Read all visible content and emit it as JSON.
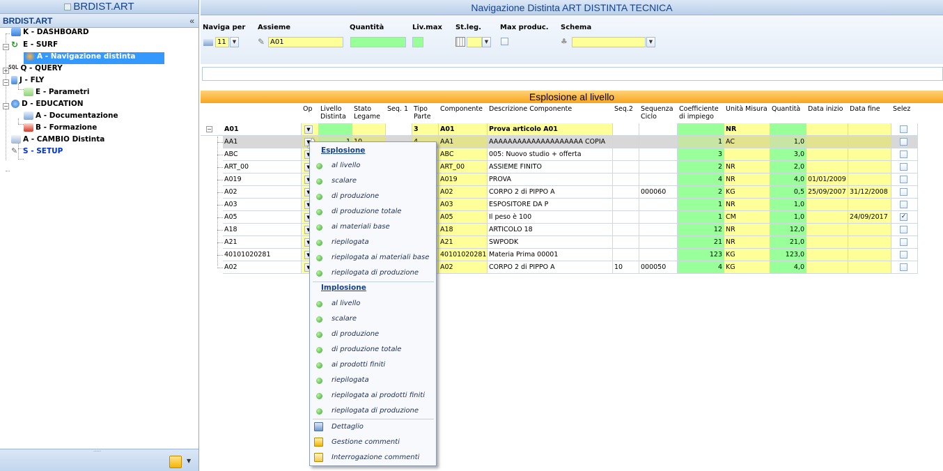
{
  "sidebar": {
    "window_title": "BRDIST.ART",
    "panel_title": "BRDIST.ART",
    "collapse_glyph": "«",
    "tree": [
      {
        "label": "K - DASHBOARD"
      },
      {
        "label": "E - SURF"
      },
      {
        "label": "A - Navigazione distinta"
      },
      {
        "label": "Q - QUERY",
        "prefix": "SQL"
      },
      {
        "label": "J - FLY"
      },
      {
        "label": "E - Parametri"
      },
      {
        "label": "D - EDUCATION"
      },
      {
        "label": "A - Documentazione"
      },
      {
        "label": "B - Formazione"
      },
      {
        "label": "A - CAMBIO Distinta"
      },
      {
        "label": "S - SETUP"
      }
    ]
  },
  "header": {
    "title": "Navigazione Distinta ART DISTINTA TECNICA"
  },
  "params": {
    "labels": {
      "naviga_per": "Naviga per",
      "assieme": "Assieme",
      "quantita": "Quantità",
      "livmax": "Liv.max",
      "stleg": "St.leg.",
      "maxproduc": "Max produc.",
      "schema": "Schema"
    },
    "naviga_per_value": "11",
    "assieme_value": "A01",
    "quantita_value": "",
    "livmax_value": "",
    "schema_value": ""
  },
  "grid": {
    "title": "Esplosione al livello",
    "columns": [
      "Op",
      "Livello Distinta",
      "Stato Legame",
      "Seq. 1",
      "Tipo Parte",
      "Componente",
      "Descrizione Componente",
      "Seq.2",
      "Sequenza Ciclo",
      "Coefficiente di impiego",
      "Unità Misura",
      "Quantità",
      "Data inizio",
      "Data fine",
      "Selez"
    ],
    "root": {
      "code": "A01",
      "tipo": "3",
      "componente": "A01",
      "descrizione": "Prova articolo A01",
      "um": "NR"
    },
    "rows": [
      {
        "code": "AA1",
        "livello": "1",
        "stato": "10",
        "tipo": "4",
        "componente": "AA1",
        "descrizione": "AAAAAAAAAAAAAAAAAAAA COPIA",
        "seq2": "",
        "ciclo": "",
        "coeff": "1",
        "um": "AC",
        "qty": "1,0",
        "inizio": "",
        "fine": "",
        "sel": false
      },
      {
        "code": "ABC",
        "livello": "",
        "stato": "",
        "tipo": "",
        "componente": "ABC",
        "descrizione": "005: Nuovo studio + offerta",
        "seq2": "",
        "ciclo": "",
        "coeff": "3",
        "um": "",
        "qty": "3,0",
        "inizio": "",
        "fine": "",
        "sel": false
      },
      {
        "code": "ART_00",
        "livello": "",
        "stato": "",
        "tipo": "",
        "componente": "ART_00",
        "descrizione": "ASSIEME FINITO",
        "seq2": "",
        "ciclo": "",
        "coeff": "2",
        "um": "NR",
        "qty": "2,0",
        "inizio": "",
        "fine": "",
        "sel": false
      },
      {
        "code": "A019",
        "livello": "",
        "stato": "",
        "tipo": "",
        "componente": "A019",
        "descrizione": "PROVA",
        "seq2": "",
        "ciclo": "",
        "coeff": "4",
        "um": "NR",
        "qty": "4,0",
        "inizio": "01/01/2009",
        "fine": "",
        "sel": false
      },
      {
        "code": "A02",
        "livello": "",
        "stato": "",
        "tipo": "",
        "componente": "A02",
        "descrizione": "CORPO 2 di PIPPO A",
        "seq2": "",
        "ciclo": "000060",
        "coeff": "2",
        "um": "KG",
        "qty": "0,5",
        "inizio": "25/09/2007",
        "fine": "31/12/2008",
        "sel": false
      },
      {
        "code": "A03",
        "livello": "",
        "stato": "",
        "tipo": "",
        "componente": "A03",
        "descrizione": "ESPOSITORE DA P",
        "seq2": "",
        "ciclo": "",
        "coeff": "1",
        "um": "NR",
        "qty": "1,0",
        "inizio": "",
        "fine": "",
        "sel": false
      },
      {
        "code": "A05",
        "livello": "",
        "stato": "",
        "tipo": "",
        "componente": "A05",
        "descrizione": "Il peso è 100",
        "seq2": "",
        "ciclo": "",
        "coeff": "1",
        "um": "CM",
        "qty": "1,0",
        "inizio": "",
        "fine": "24/09/2017",
        "sel": true
      },
      {
        "code": "A18",
        "livello": "",
        "stato": "",
        "tipo": "",
        "componente": "A18",
        "descrizione": "ARTICOLO 18",
        "seq2": "",
        "ciclo": "",
        "coeff": "12",
        "um": "NR",
        "qty": "12,0",
        "inizio": "",
        "fine": "",
        "sel": false
      },
      {
        "code": "A21",
        "livello": "",
        "stato": "",
        "tipo": "",
        "componente": "A21",
        "descrizione": "SWPODK",
        "seq2": "",
        "ciclo": "",
        "coeff": "21",
        "um": "NR",
        "qty": "21,0",
        "inizio": "",
        "fine": "",
        "sel": false
      },
      {
        "code": "40101020281",
        "livello": "",
        "stato": "",
        "tipo": "",
        "componente": "40101020281",
        "descrizione": "Materia Prima 00001",
        "seq2": "",
        "ciclo": "",
        "coeff": "123",
        "um": "KG",
        "qty": "123,0",
        "inizio": "",
        "fine": "",
        "sel": false
      },
      {
        "code": "A02",
        "livello": "",
        "stato": "",
        "tipo": "",
        "componente": "A02",
        "descrizione": "CORPO 2 di PIPPO A",
        "seq2": "10",
        "ciclo": "000050",
        "coeff": "4",
        "um": "KG",
        "qty": "4,0",
        "inizio": "",
        "fine": "",
        "sel": false
      }
    ]
  },
  "menu": {
    "esplosione_title": "Esplosione",
    "esplosione_items": [
      "al livello",
      "scalare",
      "di produzione",
      "di produzione totale",
      "ai materiali base",
      "riepilogata",
      "riepilogata ai materiali base",
      "riepilogata di produzione"
    ],
    "implosione_title": "Implosione",
    "implosione_items": [
      "al livello",
      "scalare",
      "di produzione",
      "di produzione totale",
      "ai prodotti finiti",
      "riepilogata",
      "riepilogata ai prodotti finiti",
      "riepilogata di produzione"
    ],
    "extra_items": [
      "Dettaglio",
      "Gestione commenti",
      "Interrogazione commenti"
    ]
  },
  "colors": {
    "accent": "#15428b",
    "yellow": "#ffff99",
    "green": "#99ff99",
    "selection": "#3399ff",
    "orange": "#f8a51b"
  }
}
